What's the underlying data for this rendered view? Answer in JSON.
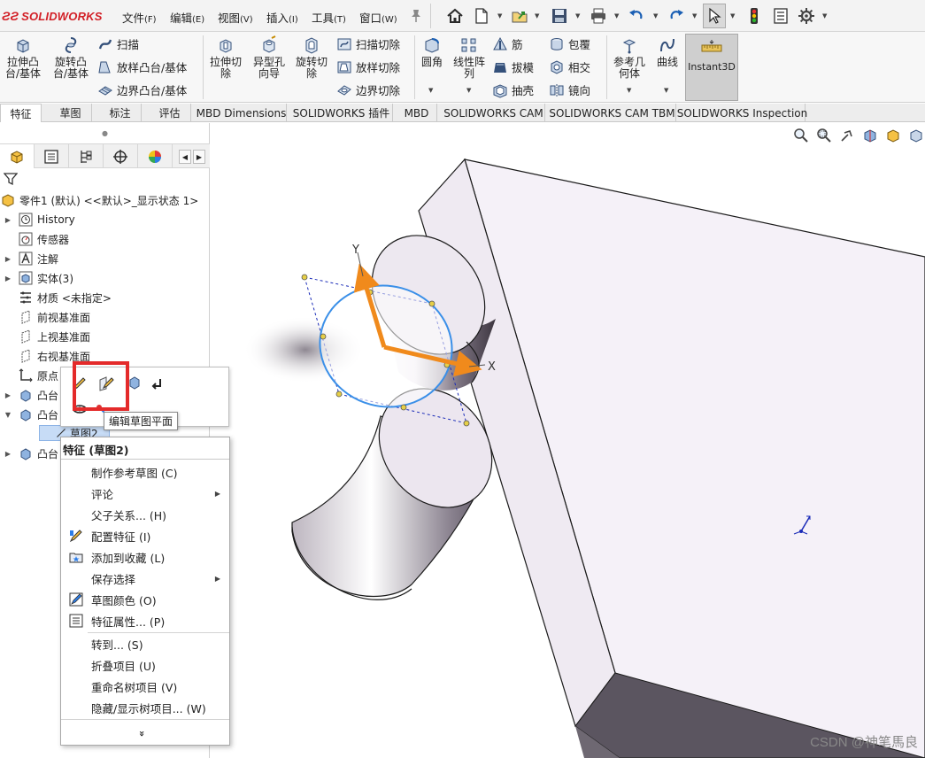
{
  "app": {
    "name": "SOLIDWORKS"
  },
  "menu": [
    {
      "label": "文件",
      "key": "(F)"
    },
    {
      "label": "编辑",
      "key": "(E)"
    },
    {
      "label": "视图",
      "key": "(V)"
    },
    {
      "label": "插入",
      "key": "(I)"
    },
    {
      "label": "工具",
      "key": "(T)"
    },
    {
      "label": "窗口",
      "key": "(W)"
    }
  ],
  "quick_access_icons": [
    "pin-icon",
    "home-icon",
    "new-document-icon",
    "open-icon",
    "save-icon",
    "print-icon",
    "undo-icon",
    "redo-icon",
    "select-icon",
    "traffic-light-icon",
    "file-properties-icon",
    "options-gear-icon"
  ],
  "ribbon": {
    "extrude_boss": "拉伸凸\n台/基体",
    "revolve_boss": "旋转凸\n台/基体",
    "sweep": "扫描",
    "loft_boss": "放样凸台/基体",
    "boundary_boss": "边界凸台/基体",
    "extrude_cut": "拉伸切\n除",
    "hole_wizard": "异型孔\n向导",
    "revolve_cut": "旋转切\n除",
    "swept_cut": "扫描切除",
    "lofted_cut": "放样切除",
    "boundary_cut": "边界切除",
    "fillet": "圆角",
    "linear_pattern": "线性阵\n列",
    "rib": "筋",
    "draft": "拔模",
    "shell": "抽壳",
    "wrap": "包覆",
    "intersect": "相交",
    "mirror": "镜向",
    "ref_geometry": "参考几\n何体",
    "curves": "曲线",
    "instant3d": "Instant3D"
  },
  "command_tabs": [
    "特征",
    "草图",
    "标注",
    "评估",
    "MBD Dimensions",
    "SOLIDWORKS 插件",
    "MBD",
    "SOLIDWORKS CAM",
    "SOLIDWORKS CAM TBM",
    "SOLIDWORKS Inspection"
  ],
  "active_tab": "特征",
  "panel_tab_icons": [
    "featuremanager-icon",
    "propertymanager-icon",
    "configurationmanager-icon",
    "dimxpert-icon",
    "display-manager-icon"
  ],
  "tree": {
    "root": "零件1 (默认) <<默认>_显示状态 1>",
    "items": [
      {
        "label": "History",
        "icon": "history-icon"
      },
      {
        "label": "传感器",
        "icon": "sensor-icon"
      },
      {
        "label": "注解",
        "icon": "annotation-icon"
      },
      {
        "label": "实体(3)",
        "icon": "solid-bodies-icon"
      },
      {
        "label": "材质 <未指定>",
        "icon": "material-icon"
      },
      {
        "label": "前视基准面",
        "icon": "plane-icon"
      },
      {
        "label": "上视基准面",
        "icon": "plane-icon"
      },
      {
        "label": "右视基准面",
        "icon": "plane-icon"
      },
      {
        "label": "原点",
        "icon": "origin-icon"
      },
      {
        "label": "凸台",
        "icon": "boss-extrude-icon"
      },
      {
        "label": "凸台",
        "icon": "boss-extrude-icon"
      },
      {
        "label": "草图2",
        "icon": "sketch-icon"
      },
      {
        "label": "凸台",
        "icon": "boss-extrude-icon"
      }
    ]
  },
  "tooltip": "编辑草图平面",
  "context_menu": {
    "title": "特征 (草图2)",
    "items": [
      {
        "label": "制作参考草图 ",
        "key": "(C)",
        "icon": "",
        "submenu": false
      },
      {
        "label": "评论",
        "key": "",
        "icon": "",
        "submenu": true
      },
      {
        "label": "父子关系... ",
        "key": "(H)",
        "icon": "",
        "submenu": false
      },
      {
        "label": "配置特征 ",
        "key": "(I)",
        "icon": "configure-feature-icon",
        "submenu": false
      },
      {
        "label": "添加到收藏 ",
        "key": "(L)",
        "icon": "add-favorite-icon",
        "submenu": false
      },
      {
        "label": "保存选择",
        "key": "",
        "icon": "",
        "submenu": true
      },
      {
        "label": "草图颜色 ",
        "key": "(O)",
        "icon": "sketch-color-icon",
        "submenu": false
      },
      {
        "label": "特征属性... ",
        "key": "(P)",
        "icon": "feature-properties-icon",
        "submenu": false
      },
      {
        "label": "转到... ",
        "key": "(S)",
        "icon": "",
        "submenu": false
      },
      {
        "label": "折叠项目 ",
        "key": "(U)",
        "icon": "",
        "submenu": false
      },
      {
        "label": "重命名树项目 ",
        "key": "(V)",
        "icon": "",
        "submenu": false
      },
      {
        "label": "隐藏/显示树项目... ",
        "key": "(W)",
        "icon": "",
        "submenu": false
      }
    ],
    "more": "»"
  },
  "viewport": {
    "axis_x": "X",
    "axis_y": "Y",
    "hud_icons": [
      "zoom-to-fit-icon",
      "zoom-to-area-icon",
      "previous-view-icon",
      "section-view-icon",
      "view-orientation-icon",
      "display-style-icon"
    ]
  },
  "watermark": "CSDN @神笔馬良"
}
